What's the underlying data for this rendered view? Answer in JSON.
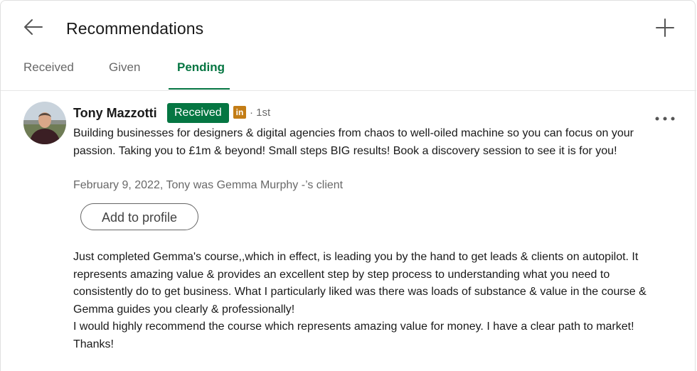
{
  "header": {
    "title": "Recommendations",
    "back_icon": "arrow-left-icon",
    "add_icon": "plus-icon"
  },
  "tabs": [
    {
      "label": "Received",
      "active": false
    },
    {
      "label": "Given",
      "active": false
    },
    {
      "label": "Pending",
      "active": true
    }
  ],
  "colors": {
    "accent": "#057642",
    "linkedin_icon": "#c37d16"
  },
  "recommendation": {
    "name": "Tony Mazzotti",
    "status_badge": "Received",
    "degree": "· 1st",
    "headline": "Building businesses for designers & digital agencies from chaos to well-oiled machine so you can focus on your passion. Taking you to £1m & beyond! Small steps BIG results! Book a discovery session to see it is for you!",
    "meta": "February 9, 2022, Tony was Gemma Murphy -’s client",
    "add_button": "Add to profile",
    "text_p1": "Just completed Gemma's course,,which in effect, is leading you by the hand to get leads & clients on autopilot. It represents amazing value & provides an excellent step by step process to understanding what you need to consistently do to get business. What I particularly liked was there was loads of substance & value in the course & Gemma guides you clearly & professionally!",
    "text_p2": "I would highly recommend the course which represents amazing value for money. I have a clear path to market! Thanks!"
  }
}
